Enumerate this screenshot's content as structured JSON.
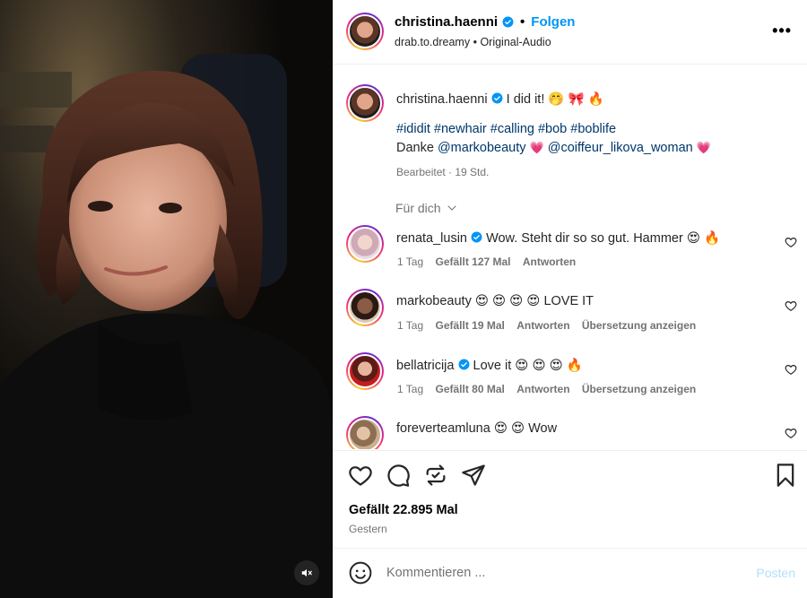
{
  "header": {
    "username": "christina.haenni",
    "follow_label": "Folgen",
    "audio_author": "drab.to.dreamy",
    "audio_sep": "•",
    "audio_title": "Original-Audio",
    "more_label": "•••"
  },
  "caption": {
    "username": "christina.haenni",
    "text": "I did it! 🤭 🎀 🔥",
    "hashtags": "#ididit #newhair #calling #bob #boblife",
    "thanks_prefix": "Danke",
    "mention1": "@markobeauty",
    "emoji1": "💗",
    "mention2": "@coiffeur_likova_woman",
    "emoji2": "💗",
    "meta": "Bearbeitet · 19 Std."
  },
  "filter_label": "Für dich",
  "comments": [
    {
      "username": "renata_lusin",
      "verified": true,
      "text": "Wow. Steht dir so so gut. Hammer 😍 🔥",
      "time": "1 Tag",
      "likes": "Gefällt 127 Mal",
      "reply": "Antworten",
      "translate": ""
    },
    {
      "username": "markobeauty",
      "verified": false,
      "text": "😍 😍 😍 😍 LOVE IT",
      "time": "1 Tag",
      "likes": "Gefällt 19 Mal",
      "reply": "Antworten",
      "translate": "Übersetzung anzeigen"
    },
    {
      "username": "bellatricija",
      "verified": true,
      "text": "Love it 😍 😍 😍 🔥",
      "time": "1 Tag",
      "likes": "Gefällt 80 Mal",
      "reply": "Antworten",
      "translate": "Übersetzung anzeigen"
    },
    {
      "username": "foreverteamluna",
      "verified": false,
      "text": "😍 😍 Wow",
      "time": "",
      "likes": "",
      "reply": "",
      "translate": ""
    }
  ],
  "stats": {
    "likes": "Gefällt 22.895 Mal",
    "date": "Gestern"
  },
  "composer": {
    "placeholder": "Kommentieren ...",
    "post_label": "Posten"
  },
  "icons": {
    "like": "heart-icon",
    "comment": "comment-bubble-icon",
    "share": "repost-icon",
    "send": "paper-plane-icon",
    "save": "bookmark-icon",
    "mute": "speaker-muted-icon",
    "emoji": "smiley-icon"
  },
  "colors": {
    "link": "#0095f6",
    "hashtag": "#00376b",
    "muted": "#737373",
    "post_disabled": "#b2dffc"
  }
}
